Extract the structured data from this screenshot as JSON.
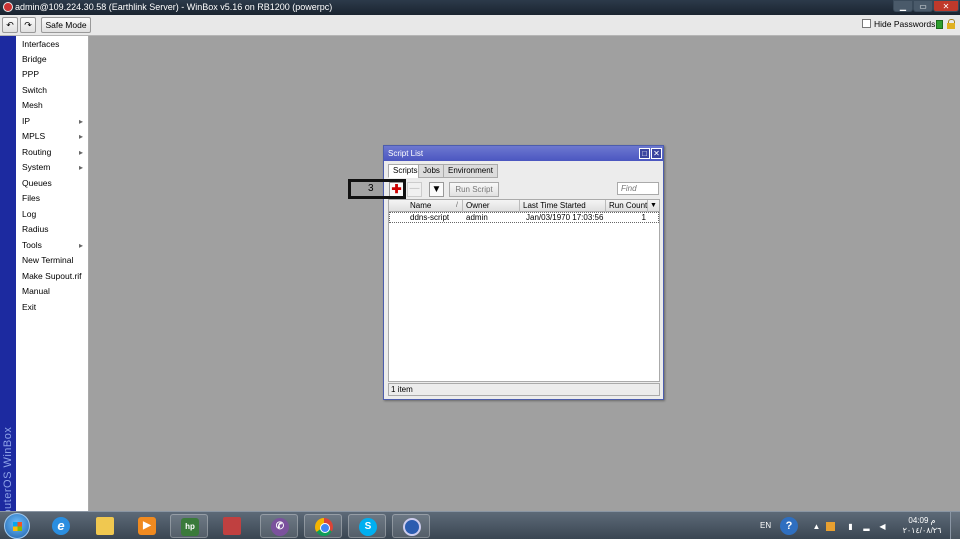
{
  "window": {
    "title": "admin@109.224.30.58 (Earthlink Server) - WinBox v5.16 on RB1200 (powerpc)",
    "min": "▁",
    "max": "▭",
    "close": "✕"
  },
  "toolbar": {
    "undo": "↶",
    "redo": "↷",
    "safe_mode": "Safe Mode",
    "hide_passwords": "Hide Passwords"
  },
  "sidebar": {
    "brand": "RouterOS WinBox",
    "items": [
      {
        "label": "Interfaces",
        "arrow": ""
      },
      {
        "label": "Bridge",
        "arrow": ""
      },
      {
        "label": "PPP",
        "arrow": ""
      },
      {
        "label": "Switch",
        "arrow": ""
      },
      {
        "label": "Mesh",
        "arrow": ""
      },
      {
        "label": "IP",
        "arrow": "▸"
      },
      {
        "label": "MPLS",
        "arrow": "▸"
      },
      {
        "label": "Routing",
        "arrow": "▸"
      },
      {
        "label": "System",
        "arrow": "▸"
      },
      {
        "label": "Queues",
        "arrow": ""
      },
      {
        "label": "Files",
        "arrow": ""
      },
      {
        "label": "Log",
        "arrow": ""
      },
      {
        "label": "Radius",
        "arrow": ""
      },
      {
        "label": "Tools",
        "arrow": "▸"
      },
      {
        "label": "New Terminal",
        "arrow": ""
      },
      {
        "label": "Make Supout.rif",
        "arrow": ""
      },
      {
        "label": "Manual",
        "arrow": ""
      },
      {
        "label": "Exit",
        "arrow": ""
      }
    ]
  },
  "dialog": {
    "title": "Script List",
    "max": "□",
    "close": "✕",
    "tabs": [
      "Scripts",
      "Jobs",
      "Environment"
    ],
    "add": "✚",
    "remove": "—",
    "filter": "▼",
    "run_script": "Run Script",
    "find_placeholder": "Find",
    "columns": {
      "name": "Name",
      "sort": "/",
      "owner": "Owner",
      "last": "Last Time Started",
      "run": "Run Count",
      "menu": "▼"
    },
    "rows": [
      {
        "name": "ddns-script",
        "owner": "admin",
        "last": "Jan/03/1970 17:03:56",
        "run": "1"
      }
    ],
    "status": "1 item",
    "annotation": "3"
  },
  "taskbar": {
    "lang": "EN",
    "help": "?",
    "time": "04:09 م",
    "date": "٢٠١٤/٠٨/٢٦"
  },
  "colors": {
    "accent": "#4b56c0",
    "sidebar_strip": "#1c2aa0",
    "desktop": "#a0a0a0"
  }
}
